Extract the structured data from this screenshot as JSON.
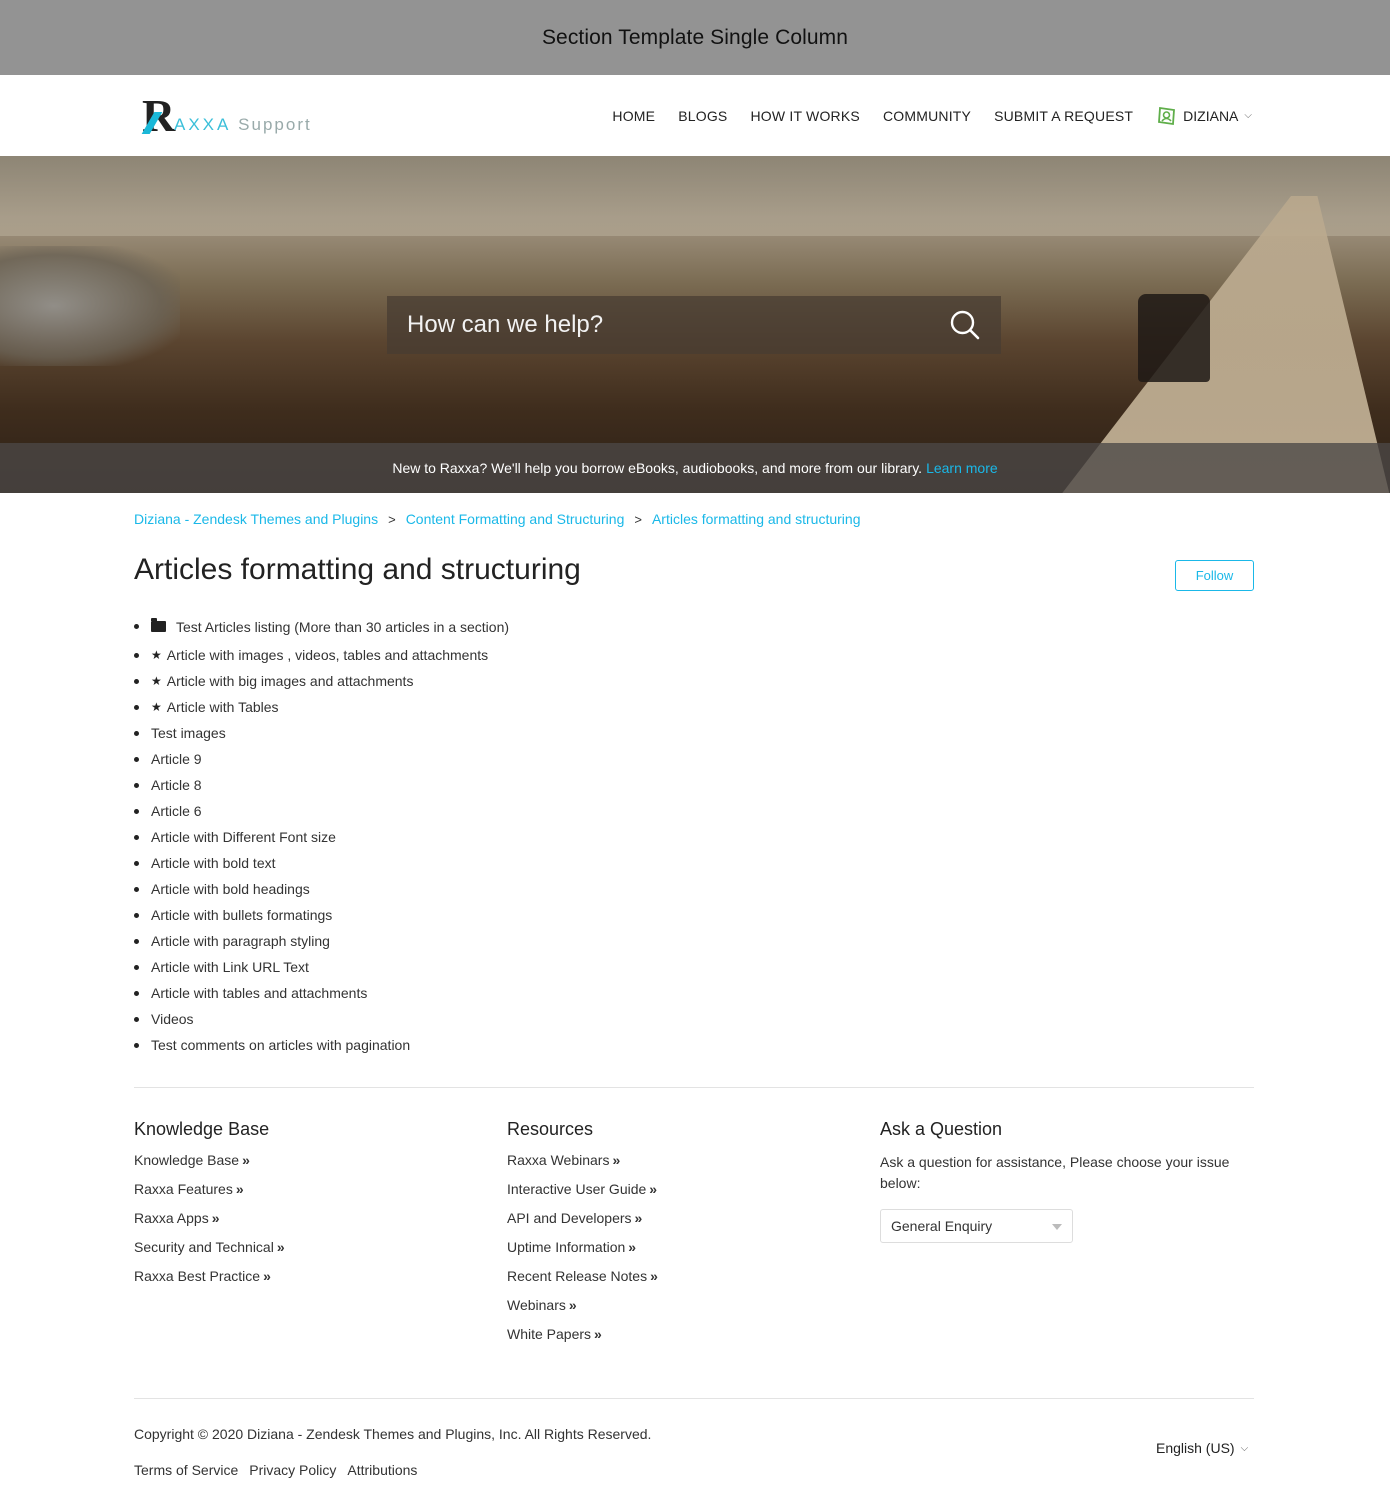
{
  "window_title": "Section Template Single Column",
  "brand": {
    "logo_letter": "R",
    "logo_text": "AXXA",
    "logo_suffix": "Support"
  },
  "nav": {
    "items": [
      "HOME",
      "BLOGS",
      "HOW IT WORKS",
      "COMMUNITY",
      "SUBMIT A REQUEST"
    ],
    "user_label": "DIZIANA"
  },
  "search": {
    "placeholder": "How can we help?"
  },
  "promo": {
    "text": "New to Raxxa? We'll help you borrow eBooks, audiobooks, and more from our library.",
    "link": "Learn more"
  },
  "breadcrumb": [
    "Diziana - Zendesk Themes and Plugins",
    "Content Formatting and Structuring",
    "Articles formatting and structuring"
  ],
  "breadcrumb_sep": ">",
  "page": {
    "title": "Articles formatting and structuring",
    "follow_label": "Follow"
  },
  "articles": [
    {
      "label": "Test Articles listing (More than 30 articles in a section)",
      "icon": "folder-icon"
    },
    {
      "label": "Article with images , videos, tables and attachments",
      "icon": "star-icon"
    },
    {
      "label": "Article with big images and attachments",
      "icon": "star-icon"
    },
    {
      "label": "Article with Tables",
      "icon": "star-icon"
    },
    {
      "label": "Test images"
    },
    {
      "label": "Article 9"
    },
    {
      "label": "Article 8"
    },
    {
      "label": "Article 6"
    },
    {
      "label": "Article with Different Font size"
    },
    {
      "label": "Article with bold text"
    },
    {
      "label": "Article with bold headings"
    },
    {
      "label": "Article with bullets formatings"
    },
    {
      "label": "Article with paragraph styling"
    },
    {
      "label": "Article with Link URL Text"
    },
    {
      "label": "Article with tables and attachments"
    },
    {
      "label": "Videos"
    },
    {
      "label": "Test comments on articles with pagination"
    }
  ],
  "footer": {
    "knowledge_base": {
      "heading": "Knowledge Base",
      "links": [
        "Knowledge Base",
        "Raxxa Features",
        "Raxxa Apps",
        "Security and Technical",
        "Raxxa Best Practice"
      ]
    },
    "resources": {
      "heading": "Resources",
      "links": [
        "Raxxa Webinars",
        "Interactive User Guide",
        "API and Developers",
        "Uptime Information",
        "Recent Release Notes",
        "Webinars",
        "White Papers"
      ]
    },
    "ask": {
      "heading": "Ask a Question",
      "text": "Ask a question for assistance, Please choose your issue below:",
      "select_value": "General Enquiry"
    },
    "link_suffix": "»"
  },
  "copyright": "Copyright © 2020 Diziana - Zendesk Themes and Plugins, Inc. All Rights Reserved.",
  "legal": [
    "Terms of Service",
    "Privacy Policy",
    "Attributions"
  ],
  "language": "English (US)",
  "colors": {
    "accent": "#1ab8e8",
    "topbar": "#939393",
    "text": "#222222"
  }
}
